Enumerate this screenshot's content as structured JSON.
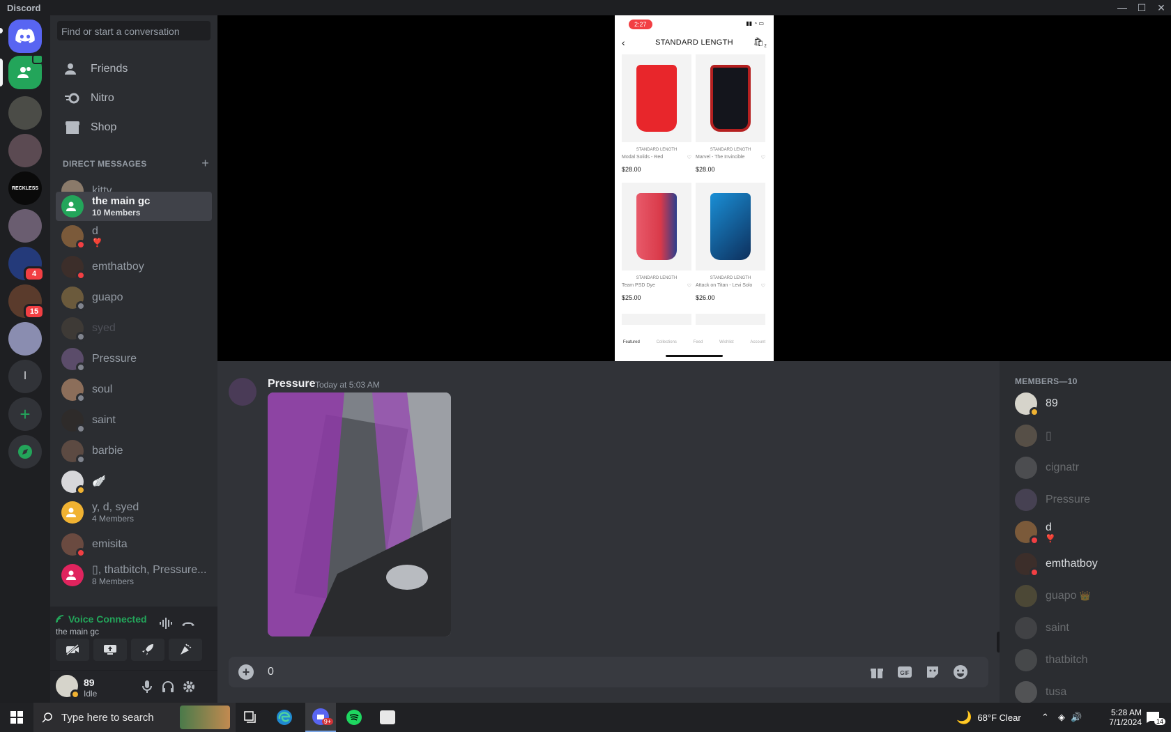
{
  "app": {
    "title": "Discord",
    "window_controls": [
      "minimize-icon",
      "maximize-icon",
      "close-icon"
    ]
  },
  "rail": {
    "guild_badges": [
      "4",
      "15"
    ],
    "letter_guild": "l",
    "reckless": "RECKLESS"
  },
  "dm_panel": {
    "search_placeholder": "Find or start a conversation",
    "nav": [
      {
        "label": "Friends",
        "icon": "friends-icon"
      },
      {
        "label": "Nitro",
        "icon": "nitro-icon"
      },
      {
        "label": "Shop",
        "icon": "shop-icon"
      }
    ],
    "header": "DIRECT MESSAGES",
    "items": [
      {
        "name": "kitty",
        "status": "dnd"
      },
      {
        "name": "the main gc",
        "sub": "10 Members",
        "group": true,
        "selected": true
      },
      {
        "name": "d",
        "sub": "❣️",
        "status": "dnd"
      },
      {
        "name": "emthatboy",
        "status": "dnd"
      },
      {
        "name": "guapo",
        "status": "offline"
      },
      {
        "name": "syed",
        "status": "offline"
      },
      {
        "name": "Pressure",
        "status": "offline"
      },
      {
        "name": "soul",
        "status": "offline"
      },
      {
        "name": "saint",
        "status": "offline"
      },
      {
        "name": "barbie",
        "status": "offline"
      },
      {
        "name": "🪽",
        "status": "idle"
      },
      {
        "name": "y, d, syed",
        "sub": "4 Members",
        "group": true
      },
      {
        "name": "emisita",
        "status": "dnd"
      },
      {
        "name": "▯, thatbitch, Pressure...",
        "sub": "8 Members",
        "group": true
      }
    ]
  },
  "voice": {
    "status": "Voice Connected",
    "channel": "the main gc"
  },
  "user": {
    "name": "89",
    "status": "Idle"
  },
  "stream": {
    "phone_time": "2:27",
    "page_title": "STANDARD LENGTH",
    "bag_count": "2",
    "products": [
      {
        "category": "STANDARD LENGTH",
        "name": "Modal Solids - Red",
        "price": "$28.00",
        "color": "#e8262b"
      },
      {
        "category": "STANDARD LENGTH",
        "name": "Marvel - The Invincible",
        "price": "$28.00",
        "color": "#14151c"
      },
      {
        "category": "STANDARD LENGTH",
        "name": "Team PSD Dye",
        "price": "$25.00",
        "color": "#d93a4a"
      },
      {
        "category": "STANDARD LENGTH",
        "name": "Attack on Titan - Levi Solo",
        "price": "$26.00",
        "color": "#1a8fd6"
      }
    ],
    "tabs": [
      "Featured",
      "Collections",
      "Feed",
      "Wishlist",
      "Account"
    ]
  },
  "chat": {
    "message": {
      "author": "Pressure",
      "time": "Today at 5:03 AM"
    },
    "composer_value": "0"
  },
  "members": {
    "header": "MEMBERS—10",
    "list": [
      {
        "name": "89",
        "status": "idle",
        "online": true
      },
      {
        "name": "▯",
        "online": false
      },
      {
        "name": "cignatr",
        "online": false
      },
      {
        "name": "Pressure",
        "online": false
      },
      {
        "name": "d",
        "sub": "❣️",
        "status": "dnd",
        "online": true
      },
      {
        "name": "emthatboy",
        "status": "dnd",
        "online": true
      },
      {
        "name": "guapo",
        "crown": "👑",
        "online": false
      },
      {
        "name": "saint",
        "online": false
      },
      {
        "name": "thatbitch",
        "online": false
      },
      {
        "name": "tusa",
        "online": false
      }
    ]
  },
  "taskbar": {
    "search_placeholder": "Type here to search",
    "notification_count": "9+",
    "weather": "68°F  Clear",
    "time": "5:28 AM",
    "date": "7/1/2024",
    "action_center_count": "14"
  }
}
